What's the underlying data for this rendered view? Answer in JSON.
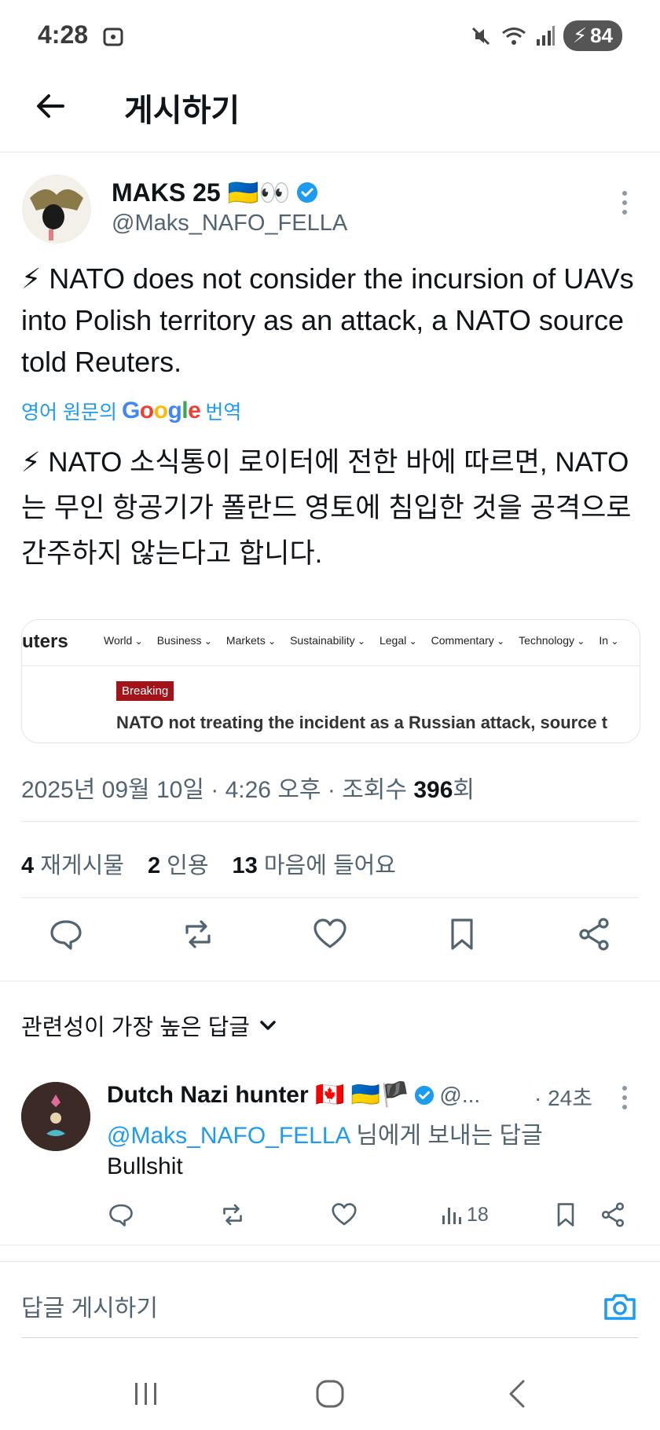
{
  "status_bar": {
    "time": "4:28",
    "battery": "84"
  },
  "header": {
    "title": "게시하기"
  },
  "tweet": {
    "display_name": "MAKS 25 🇺🇦👀",
    "handle": "@Maks_NAFO_FELLA",
    "text": "⚡ NATO does not consider the incursion of UAVs into Polish territory as an attack, a NATO source told Reuters.",
    "translate_prefix": "영어 원문의",
    "translate_brand": "Google",
    "translate_suffix": "번역",
    "translated_text": "⚡ NATO 소식통이 로이터에 전한 바에 따르면, NATO는 무인 항공기가 폴란드 영토에 침입한 것을 공격으로 간주하지 않는다고 합니다.",
    "card": {
      "logo": "uters",
      "nav": [
        "World",
        "Business",
        "Markets",
        "Sustainability",
        "Legal",
        "Commentary",
        "Technology",
        "In"
      ],
      "badge": "Breaking",
      "headline": "NATO not treating the incident as a Russian attack, source t"
    },
    "timestamp": "2025년 09월 10일 · 4:26 오후 · 조회수 ",
    "views": "396",
    "views_suffix": "회",
    "stats": {
      "reposts_count": "4",
      "reposts_label": "재게시물",
      "quotes_count": "2",
      "quotes_label": "인용",
      "likes_count": "13",
      "likes_label": "마음에 들어요"
    }
  },
  "sort_label": "관련성이 가장 높은 답글",
  "reply": {
    "display_name": "Dutch Nazi hunter 🇨🇦 🇺🇦🏴",
    "handle_trunc": "@...",
    "time": "· 24초",
    "mention": "@Maks_NAFO_FELLA",
    "reply_to_suffix": " 님에게 보내는 답글",
    "text": "Bullshit",
    "views": "18"
  },
  "compose": {
    "placeholder": "답글 게시하기"
  },
  "colors": {
    "accent": "#1d9bf0",
    "secondary_text": "#536471",
    "breaking_badge": "#a4121a"
  }
}
